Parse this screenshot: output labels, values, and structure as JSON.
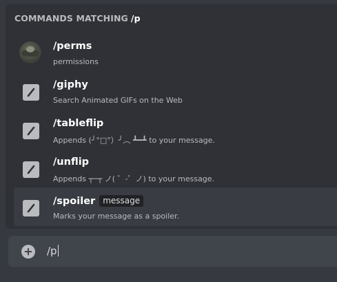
{
  "header": {
    "label": "COMMANDS MATCHING",
    "query": "/p"
  },
  "commands": [
    {
      "name": "/perms",
      "description": "permissions",
      "icon": "bot-avatar"
    },
    {
      "name": "/giphy",
      "description": "Search Animated GIFs on the Web",
      "icon": "slash-command-icon"
    },
    {
      "name": "/tableflip",
      "description": "Appends (╯°□°）╯︵ ┻━┻ to your message.",
      "icon": "slash-command-icon"
    },
    {
      "name": "/unflip",
      "description": "Appends ┬─┬ ノ( ゜-゜ノ) to your message.",
      "icon": "slash-command-icon"
    },
    {
      "name": "/spoiler",
      "param": "message",
      "description": "Marks your message as a spoiler.",
      "icon": "slash-command-icon"
    }
  ],
  "input": {
    "value": "/p"
  },
  "colors": {
    "background": "#36393f",
    "popup": "#2f3136",
    "selected": "#393c43",
    "input": "#40444b",
    "icon": "#b9bbbe"
  }
}
